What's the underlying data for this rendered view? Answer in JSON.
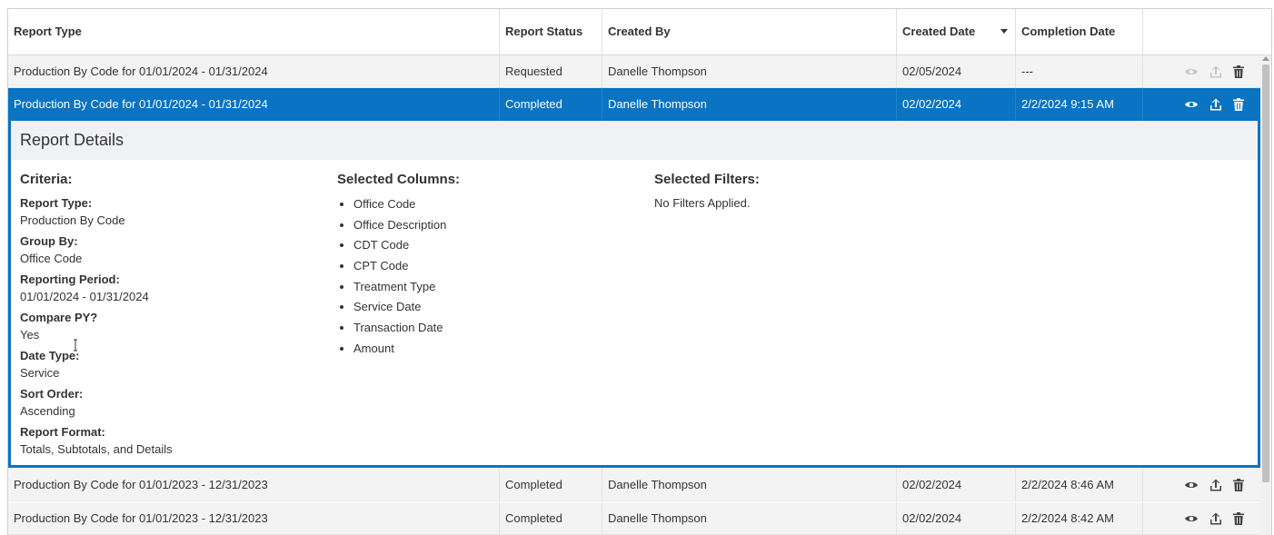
{
  "table": {
    "headers": {
      "report_type": "Report Type",
      "report_status": "Report Status",
      "created_by": "Created By",
      "created_date": "Created Date",
      "completion_date": "Completion Date"
    },
    "rows": [
      {
        "report_type": "Production By Code for 01/01/2024 - 01/31/2024",
        "status": "Requested",
        "created_by": "Danelle Thompson",
        "created_date": "02/05/2024",
        "completion_date": "---"
      },
      {
        "report_type": "Production By Code for 01/01/2024 - 01/31/2024",
        "status": "Completed",
        "created_by": "Danelle Thompson",
        "created_date": "02/02/2024",
        "completion_date": "2/2/2024 9:15 AM"
      },
      {
        "report_type": "Production By Code for 01/01/2023 - 12/31/2023",
        "status": "Completed",
        "created_by": "Danelle Thompson",
        "created_date": "02/02/2024",
        "completion_date": "2/2/2024 8:46 AM"
      },
      {
        "report_type": "Production By Code for 01/01/2023 - 12/31/2023",
        "status": "Completed",
        "created_by": "Danelle Thompson",
        "created_date": "02/02/2024",
        "completion_date": "2/2/2024 8:42 AM"
      }
    ]
  },
  "details": {
    "title": "Report Details",
    "criteria": {
      "heading": "Criteria:",
      "items": [
        {
          "label": "Report Type:",
          "value": "Production By Code"
        },
        {
          "label": "Group By:",
          "value": "Office Code"
        },
        {
          "label": "Reporting Period:",
          "value": "01/01/2024 - 01/31/2024"
        },
        {
          "label": "Compare PY?",
          "value": "Yes"
        },
        {
          "label": "Date Type:",
          "value": "Service"
        },
        {
          "label": "Sort Order:",
          "value": "Ascending"
        },
        {
          "label": "Report Format:",
          "value": "Totals, Subtotals, and Details"
        }
      ]
    },
    "columns": {
      "heading": "Selected Columns:",
      "items": [
        "Office Code",
        "Office Description",
        "CDT Code",
        "CPT Code",
        "Treatment Type",
        "Service Date",
        "Transaction Date",
        "Amount"
      ]
    },
    "filters": {
      "heading": "Selected Filters:",
      "text": "No Filters Applied."
    }
  },
  "icons": {
    "view": "eye-icon",
    "export": "upload-icon",
    "delete": "trash-icon"
  },
  "colors": {
    "selected_row": "#0a73c2",
    "row_bg": "#f3f3f3",
    "detail_title_bg": "#f0f1f3"
  }
}
